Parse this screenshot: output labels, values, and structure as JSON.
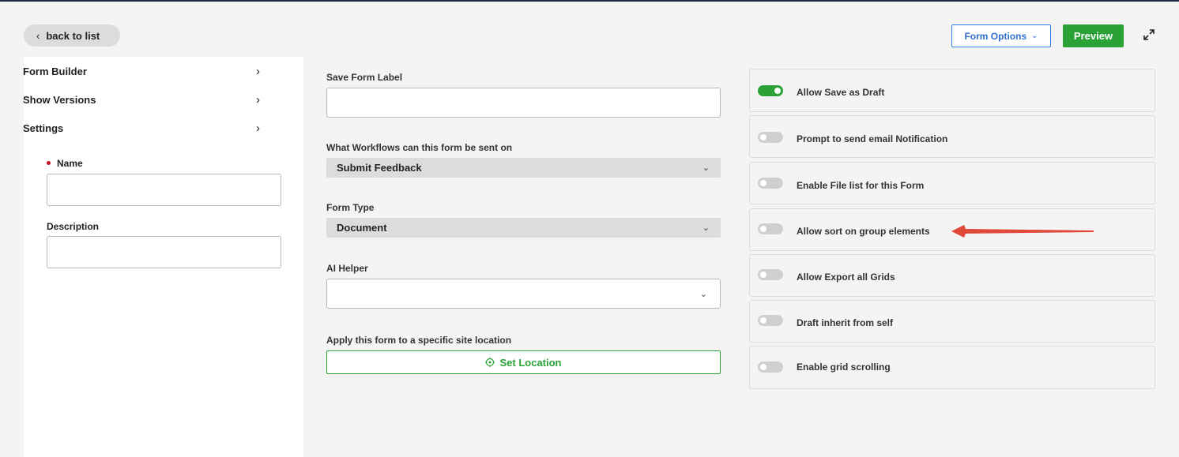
{
  "header": {
    "back_label": "back to list",
    "form_options_label": "Form Options",
    "preview_label": "Preview"
  },
  "sidebar": {
    "items": [
      {
        "label": "Form Builder"
      },
      {
        "label": "Show Versions"
      },
      {
        "label": "Settings"
      }
    ],
    "name_label": "Name",
    "name_value": "",
    "description_label": "Description",
    "description_value": ""
  },
  "main": {
    "save_form_label": "Save Form Label",
    "save_form_value": "",
    "workflows_label": "What Workflows can this form be sent on",
    "workflows_value": "Submit Feedback",
    "form_type_label": "Form Type",
    "form_type_value": "Document",
    "ai_helper_label": "AI Helper",
    "ai_helper_value": "",
    "location_label": "Apply this form to a specific site location",
    "set_location_label": "Set Location"
  },
  "options": [
    {
      "label": "Allow Save as Draft",
      "enabled": true
    },
    {
      "label": "Prompt to send email Notification",
      "enabled": false
    },
    {
      "label": "Enable File list for this Form",
      "enabled": false
    },
    {
      "label": "Allow sort on group elements",
      "enabled": false
    },
    {
      "label": "Allow Export all Grids",
      "enabled": false
    },
    {
      "label": "Draft inherit from self",
      "enabled": false
    },
    {
      "label": "Enable grid scrolling",
      "enabled": false
    }
  ],
  "colors": {
    "accent_green": "#2aa236",
    "accent_blue": "#2e6fd1",
    "annotation_red": "#e0483a",
    "required_red": "#c0101a"
  },
  "icons": {
    "back": "chevron-left-icon",
    "form_options": "chevron-down-icon",
    "expand": "expand-icon",
    "nav": "chevron-right-icon",
    "set_location": "target-icon"
  }
}
